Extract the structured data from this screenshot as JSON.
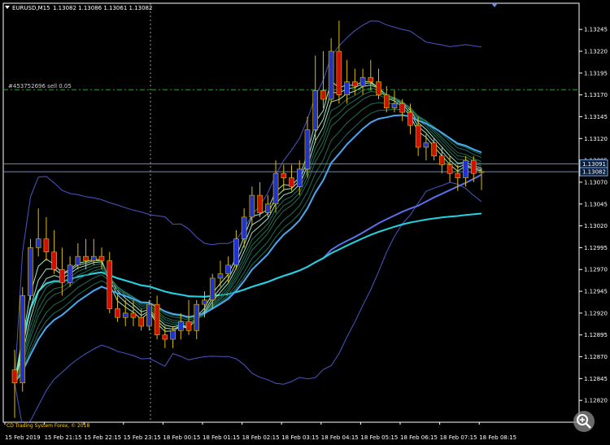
{
  "header": {
    "symbol_label": "EURUSD,M15",
    "ohlc_label": "1.13082 1.13086 1.13061 1.13082"
  },
  "order_line": {
    "label": "#453752696 sell 0.05",
    "price": 1.13176,
    "color": "#2f9b3a"
  },
  "brand_text": "CD Trading System Forex, © 2018",
  "colors": {
    "bull": "#2233cc",
    "bear": "#cc1100",
    "wick": "#e0c000",
    "grid": "#ffffff",
    "price_line": "#6a8cc8",
    "bands": "#4a56c8",
    "mid": "#5a70e8",
    "slow": "#22d3e0",
    "ribbon_dark": "#1f6f58",
    "ribbon_light": "#9fe8c8",
    "outer": "#4aa8f0"
  },
  "chart_data": {
    "type": "candlestick",
    "ylim": [
      1.12795,
      1.13275
    ],
    "y_ticks": [
      "1.13245",
      "1.13220",
      "1.13195",
      "1.13170",
      "1.13145",
      "1.13120",
      "1.13095",
      "1.13070",
      "1.13045",
      "1.13020",
      "1.12995",
      "1.12970",
      "1.12945",
      "1.12920",
      "1.12895",
      "1.12870",
      "1.12845",
      "1.12820"
    ],
    "x_ticks": [
      "15 Feb 2019",
      "15 Feb 21:15",
      "15 Feb 22:15",
      "15 Feb 23:15",
      "18 Feb 00:15",
      "18 Feb 01:15",
      "18 Feb 02:15",
      "18 Feb 03:15",
      "18 Feb 04:15",
      "18 Feb 05:15",
      "18 Feb 06:15",
      "18 Feb 07:15",
      "18 Feb 08:15"
    ],
    "price_tags": [
      "1.13091",
      "1.13082"
    ],
    "current_prices": [
      1.13091,
      1.13082
    ],
    "candles": [
      [
        1.12855,
        1.12878,
        1.128,
        1.1284
      ],
      [
        1.1284,
        1.1295,
        1.1283,
        1.1294
      ],
      [
        1.1294,
        1.13005,
        1.12935,
        1.12995
      ],
      [
        1.12995,
        1.1304,
        1.12985,
        1.13005
      ],
      [
        1.13005,
        1.1303,
        1.1298,
        1.1299
      ],
      [
        1.1299,
        1.13015,
        1.12965,
        1.1297
      ],
      [
        1.1297,
        1.12995,
        1.1294,
        1.12955
      ],
      [
        1.12955,
        1.12985,
        1.1295,
        1.12975
      ],
      [
        1.12975,
        1.13,
        1.1297,
        1.12985
      ],
      [
        1.12985,
        1.13005,
        1.1297,
        1.1298
      ],
      [
        1.1298,
        1.13005,
        1.12975,
        1.12985
      ],
      [
        1.12985,
        1.12995,
        1.1297,
        1.1298
      ],
      [
        1.1298,
        1.1299,
        1.1292,
        1.12925
      ],
      [
        1.12925,
        1.1294,
        1.1291,
        1.12915
      ],
      [
        1.12915,
        1.12935,
        1.12905,
        1.1292
      ],
      [
        1.1292,
        1.12935,
        1.12905,
        1.12915
      ],
      [
        1.12915,
        1.12925,
        1.129,
        1.12905
      ],
      [
        1.12905,
        1.12935,
        1.129,
        1.1293
      ],
      [
        1.1293,
        1.1294,
        1.1289,
        1.12895
      ],
      [
        1.12895,
        1.12905,
        1.1288,
        1.1289
      ],
      [
        1.1289,
        1.12905,
        1.1288,
        1.129
      ],
      [
        1.129,
        1.1292,
        1.1289,
        1.1291
      ],
      [
        1.1291,
        1.12935,
        1.12895,
        1.129
      ],
      [
        1.129,
        1.12935,
        1.1289,
        1.1293
      ],
      [
        1.1293,
        1.12945,
        1.12915,
        1.12935
      ],
      [
        1.12935,
        1.12965,
        1.12925,
        1.1296
      ],
      [
        1.1296,
        1.1298,
        1.1295,
        1.12965
      ],
      [
        1.12965,
        1.12985,
        1.12955,
        1.12975
      ],
      [
        1.12975,
        1.13015,
        1.1297,
        1.13005
      ],
      [
        1.13005,
        1.1304,
        1.12995,
        1.1303
      ],
      [
        1.1303,
        1.13065,
        1.1302,
        1.13055
      ],
      [
        1.13055,
        1.1307,
        1.1303,
        1.13035
      ],
      [
        1.13035,
        1.13055,
        1.1303,
        1.13045
      ],
      [
        1.13045,
        1.13095,
        1.13035,
        1.1308
      ],
      [
        1.1308,
        1.1309,
        1.1306,
        1.13075
      ],
      [
        1.13075,
        1.1309,
        1.1306,
        1.13065
      ],
      [
        1.13065,
        1.13095,
        1.13055,
        1.13085
      ],
      [
        1.13085,
        1.13145,
        1.13075,
        1.1313
      ],
      [
        1.1313,
        1.13215,
        1.13115,
        1.13175
      ],
      [
        1.13175,
        1.1322,
        1.13155,
        1.13165
      ],
      [
        1.13165,
        1.13235,
        1.1316,
        1.1322
      ],
      [
        1.1322,
        1.13255,
        1.1316,
        1.1317
      ],
      [
        1.1317,
        1.1321,
        1.1316,
        1.13185
      ],
      [
        1.13185,
        1.132,
        1.1317,
        1.1318
      ],
      [
        1.1318,
        1.132,
        1.1317,
        1.1319
      ],
      [
        1.1319,
        1.1321,
        1.13175,
        1.13185
      ],
      [
        1.13185,
        1.132,
        1.13165,
        1.1317
      ],
      [
        1.1317,
        1.1318,
        1.1315,
        1.13155
      ],
      [
        1.13155,
        1.13175,
        1.1315,
        1.1316
      ],
      [
        1.1316,
        1.13165,
        1.1314,
        1.1315
      ],
      [
        1.1315,
        1.1316,
        1.13125,
        1.13135
      ],
      [
        1.13135,
        1.13145,
        1.131,
        1.1311
      ],
      [
        1.1311,
        1.13125,
        1.13095,
        1.13115
      ],
      [
        1.13115,
        1.1312,
        1.13095,
        1.131
      ],
      [
        1.131,
        1.1311,
        1.1308,
        1.1309
      ],
      [
        1.1309,
        1.131,
        1.1307,
        1.1308
      ],
      [
        1.1308,
        1.1309,
        1.1306,
        1.13075
      ],
      [
        1.13075,
        1.131,
        1.13065,
        1.13095
      ],
      [
        1.13095,
        1.131,
        1.1307,
        1.1308
      ],
      [
        1.13082,
        1.13086,
        1.13061,
        1.13082
      ]
    ]
  }
}
